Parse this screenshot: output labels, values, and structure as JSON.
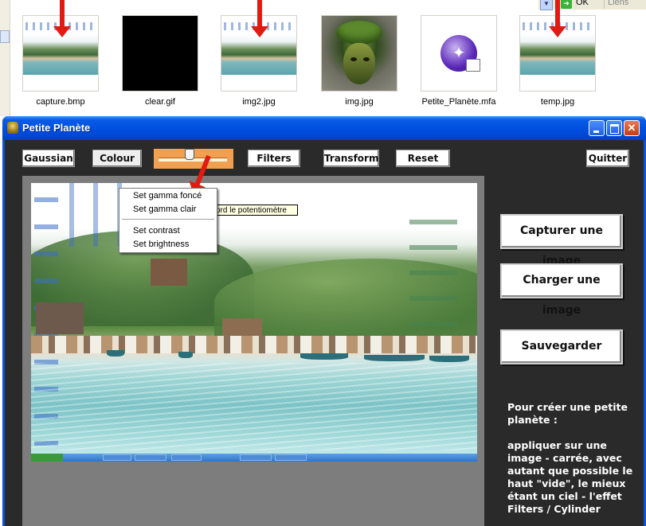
{
  "explorer": {
    "files": [
      {
        "name": "capture.bmp",
        "thumb": "island-photo",
        "arrow": true
      },
      {
        "name": "clear.gif",
        "thumb": "black",
        "arrow": false
      },
      {
        "name": "img2.jpg",
        "thumb": "island-photo",
        "arrow": true
      },
      {
        "name": "img.jpg",
        "thumb": "tree-face",
        "arrow": false
      },
      {
        "name": "Petite_Planète.mfa",
        "thumb": "mfa-app-icon",
        "arrow": false
      },
      {
        "name": "temp.jpg",
        "thumb": "island-photo",
        "arrow": true
      }
    ],
    "toolbar": {
      "ok_label": "OK",
      "links_label": "Liens"
    }
  },
  "window": {
    "title": "Petite Planète",
    "toolbar": {
      "gaussian": "Gaussian",
      "colour": "Colour",
      "filters": "Filters",
      "transform": "Transform",
      "reset": "Reset",
      "quit": "Quitter"
    },
    "slider_value": 0.45,
    "tooltip": "ord le potentiomètre",
    "colour_menu": {
      "items": [
        "Set gamma foncé",
        "Set gamma clair",
        "Set contrast",
        "Set brightness"
      ]
    },
    "side_buttons": {
      "capture": "Capturer une image",
      "load": "Charger une image",
      "save": "Sauvegarder"
    },
    "info": "Pour créer une petite planète :\n\nappliquer sur une image - carrée, avec autant que possible le haut \"vide\", le mieux étant un ciel - l'effet Filters / Cylinder"
  },
  "colors": {
    "titlebar": "#0050e0",
    "client_bg": "#2a2a2a",
    "slider_box": "#f0a050",
    "tooltip_bg": "#ffffe1",
    "arrow": "#e11b12"
  }
}
